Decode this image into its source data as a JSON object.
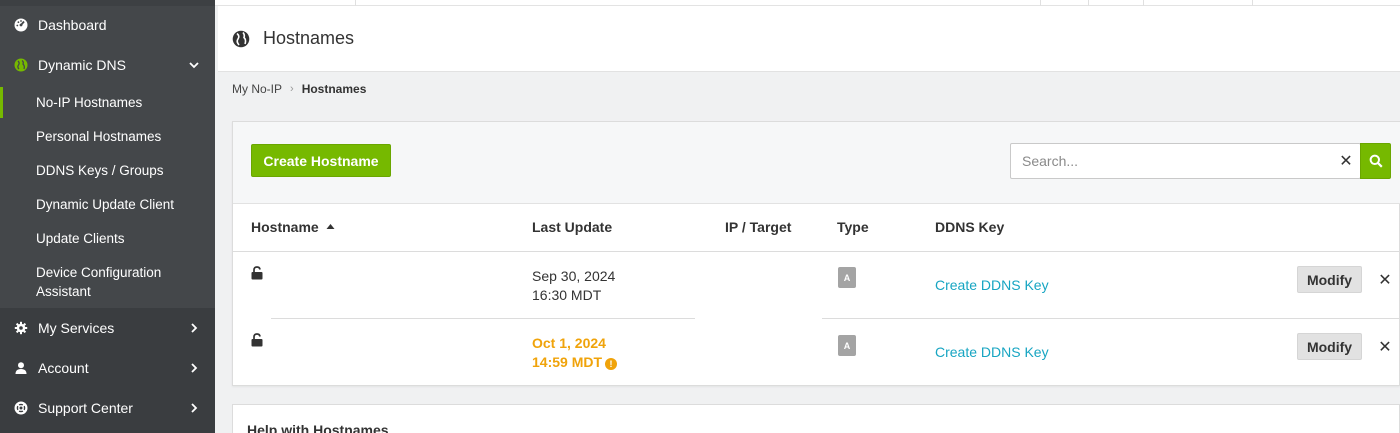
{
  "sidebar": {
    "dashboard": "Dashboard",
    "dynamic_dns": "Dynamic DNS",
    "sub_items": [
      "No-IP Hostnames",
      "Personal Hostnames",
      "DDNS Keys / Groups",
      "Dynamic Update Client",
      "Update Clients",
      "Device Configuration",
      "Assistant"
    ],
    "my_services": "My Services",
    "account": "Account",
    "support_center": "Support Center"
  },
  "header": {
    "title": "Hostnames"
  },
  "breadcrumb": {
    "root": "My No-IP",
    "current": "Hostnames"
  },
  "toolbar": {
    "create_label": "Create Hostname",
    "search_placeholder": "Search...",
    "clear_glyph": "✕"
  },
  "table": {
    "columns": {
      "hostname": "Hostname",
      "last_update": "Last Update",
      "ip_target": "IP / Target",
      "type": "Type",
      "ddns_key": "DDNS Key"
    },
    "rows": [
      {
        "date": "Sep 30, 2024",
        "time": "16:30 MDT",
        "type": "A",
        "ddns": "Create DDNS Key",
        "modify": "Modify",
        "remove": "✕"
      },
      {
        "date": "Oct 1, 2024",
        "time": "14:59 MDT",
        "type": "A",
        "ddns": "Create DDNS Key",
        "modify": "Modify",
        "remove": "✕"
      }
    ]
  },
  "help": {
    "title": "Help with Hostnames"
  },
  "colors": {
    "accent": "#76b900",
    "warning": "#f0a30a",
    "link": "#17a5c2",
    "sidebar": "#3d4043"
  },
  "icons": [
    "dashboard-icon",
    "globe-icon",
    "chevron-down-icon",
    "gear-icon",
    "user-icon",
    "lifebuoy-icon",
    "chevron-right-icon",
    "search-icon",
    "lock-icon",
    "warning-icon",
    "close-icon",
    "sort-up-icon"
  ]
}
